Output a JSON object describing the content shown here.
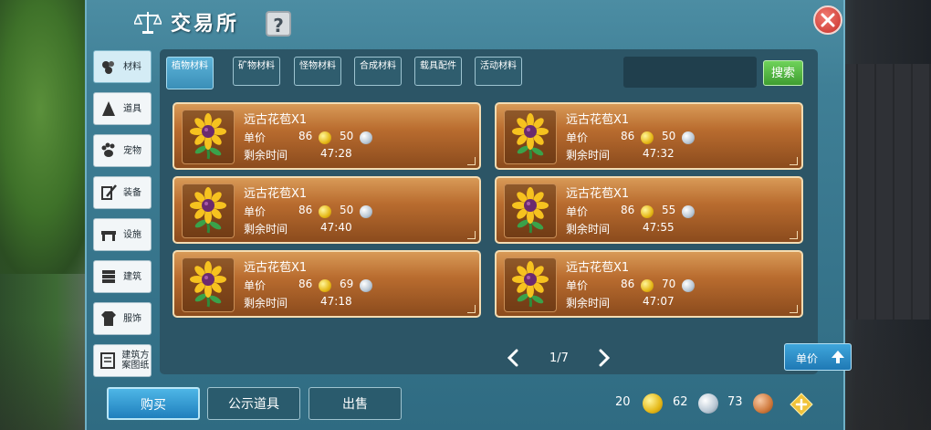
{
  "header": {
    "title": "交易所",
    "help_label": "?"
  },
  "sidebar": [
    {
      "label": "材料",
      "icon": "materials-icon",
      "active": true
    },
    {
      "label": "道具",
      "icon": "props-icon"
    },
    {
      "label": "宠物",
      "icon": "paw-icon"
    },
    {
      "label": "装备",
      "icon": "equipment-icon"
    },
    {
      "label": "设施",
      "icon": "facility-icon"
    },
    {
      "label": "建筑",
      "icon": "building-icon"
    },
    {
      "label": "服饰",
      "icon": "clothing-icon"
    },
    {
      "label": "建筑方案图纸",
      "icon": "blueprint-icon"
    }
  ],
  "tabs": [
    {
      "label": "植物材料",
      "active": true
    },
    {
      "label": "矿物材料"
    },
    {
      "label": "怪物材料"
    },
    {
      "label": "合成材料"
    },
    {
      "label": "载具配件"
    },
    {
      "label": "活动材料"
    }
  ],
  "search": {
    "value": "",
    "button": "搜索"
  },
  "listings": [
    {
      "name": "远古花苞X1",
      "unit_label": "单价",
      "gold": "86",
      "silver": "50",
      "time_label": "剩余时间",
      "time": "47:28"
    },
    {
      "name": "远古花苞X1",
      "unit_label": "单价",
      "gold": "86",
      "silver": "50",
      "time_label": "剩余时间",
      "time": "47:32"
    },
    {
      "name": "远古花苞X1",
      "unit_label": "单价",
      "gold": "86",
      "silver": "50",
      "time_label": "剩余时间",
      "time": "47:40"
    },
    {
      "name": "远古花苞X1",
      "unit_label": "单价",
      "gold": "86",
      "silver": "55",
      "time_label": "剩余时间",
      "time": "47:55"
    },
    {
      "name": "远古花苞X1",
      "unit_label": "单价",
      "gold": "86",
      "silver": "69",
      "time_label": "剩余时间",
      "time": "47:18"
    },
    {
      "name": "远古花苞X1",
      "unit_label": "单价",
      "gold": "86",
      "silver": "70",
      "time_label": "剩余时间",
      "time": "47:07"
    }
  ],
  "pager": {
    "text": "1/7"
  },
  "sort_button": "单价",
  "actions": {
    "buy": "购买",
    "showcase": "公示道具",
    "sell": "出售"
  },
  "currency": {
    "gold": "20",
    "silver": "62",
    "copper": "73"
  },
  "colors": {
    "panel": "#3f7f96",
    "listing": "#b96c2f",
    "accent_blue": "#2f8fc8",
    "search_green": "#4fb33f"
  }
}
